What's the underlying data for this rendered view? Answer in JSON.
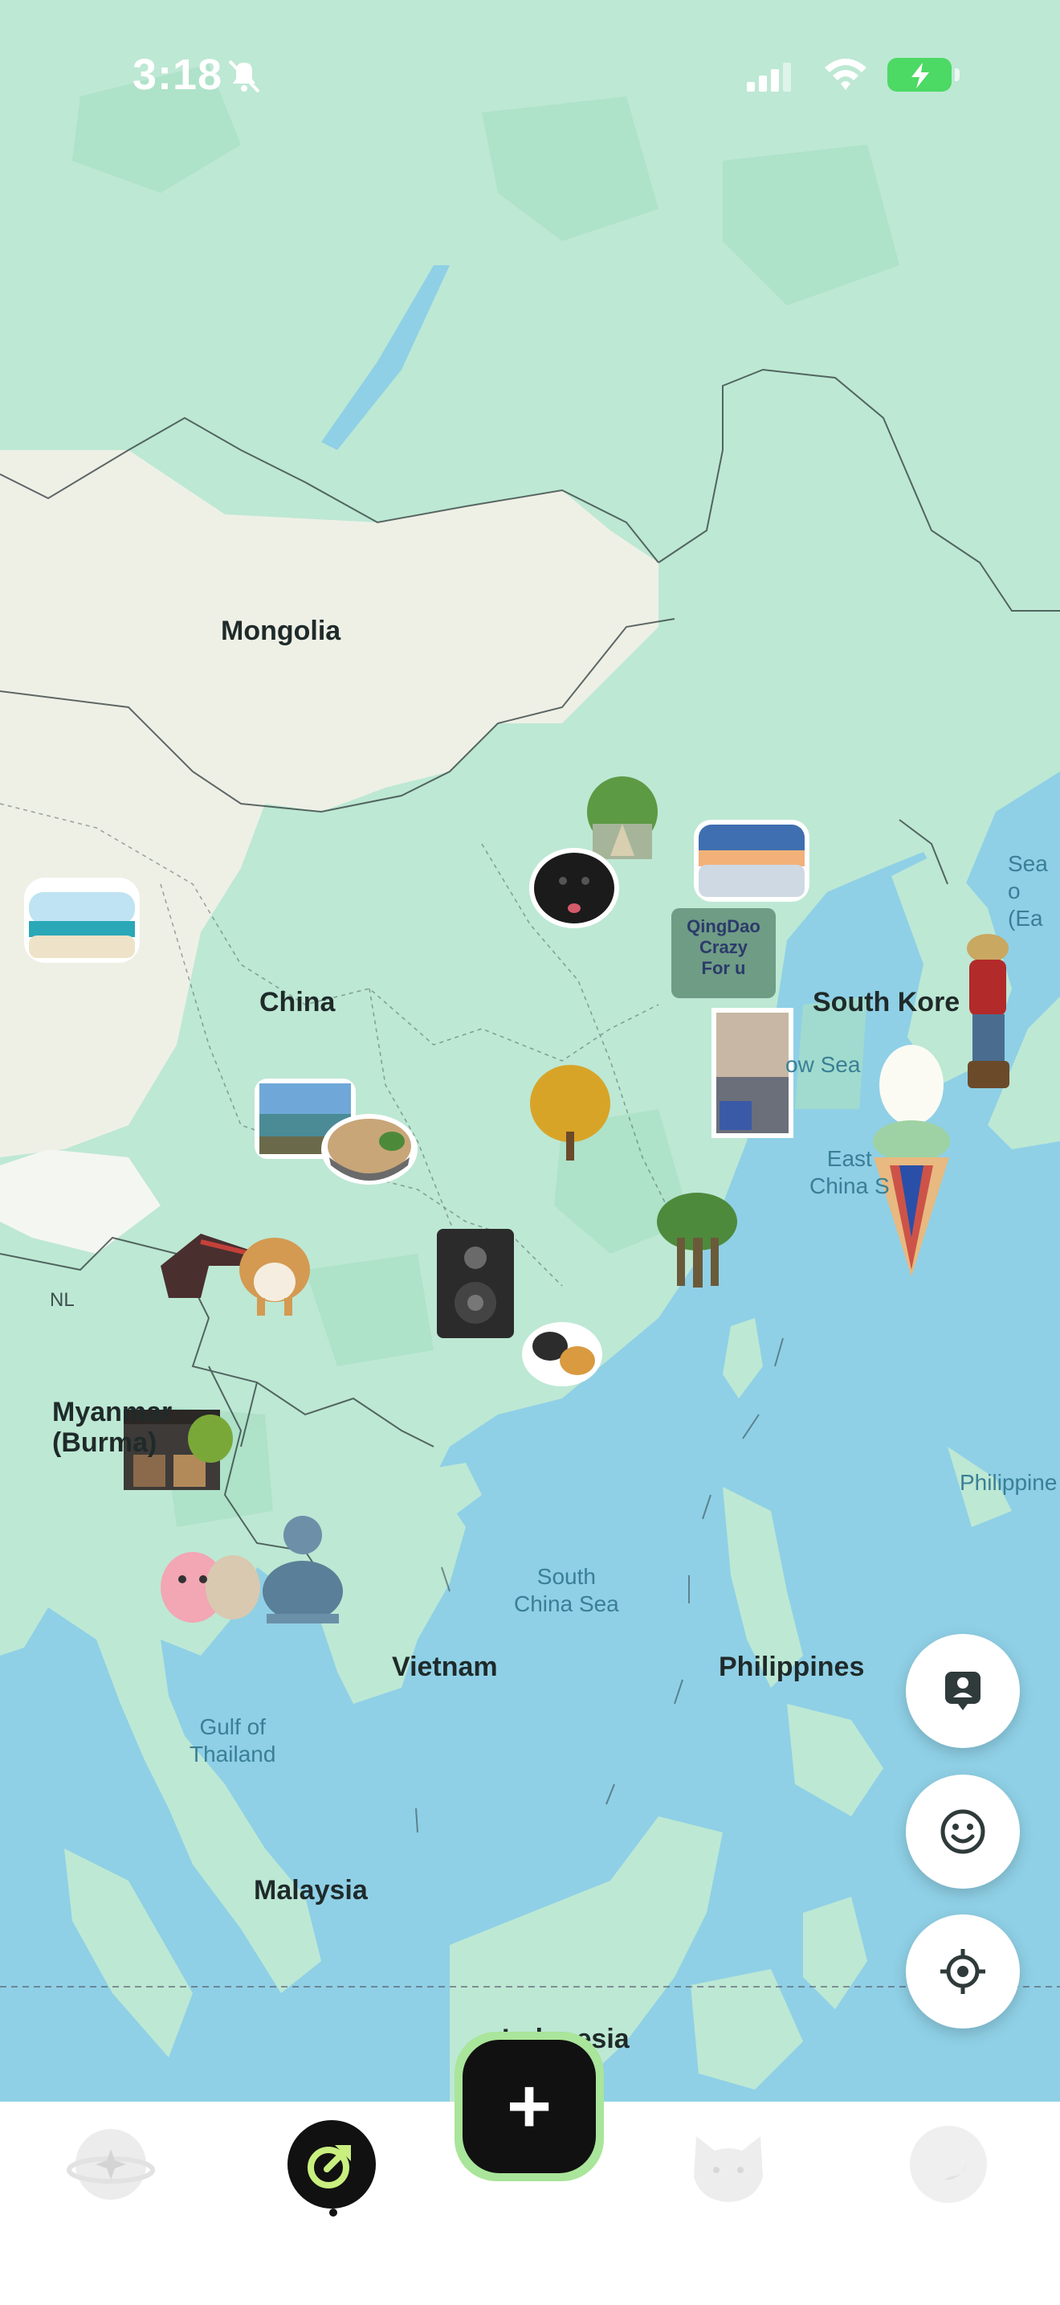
{
  "status": {
    "time": "3:18"
  },
  "map": {
    "countries": {
      "mongolia": "Mongolia",
      "china": "China",
      "south_korea": "South Kore",
      "myanmar": "Myanmar\n(Burma)",
      "vietnam": "Vietnam",
      "philippines": "Philippines",
      "malaysia": "Malaysia",
      "indonesia": "Indonesia"
    },
    "waters": {
      "south_china_sea": "South\nChina Sea",
      "gulf_of_thailand": "Gulf of\nThailand",
      "east_china_sea": "East\nChina S",
      "yellow_sea": "ow Sea",
      "sea_of_japan": "Sea o\n(Ea",
      "philippine_sea": "Philippine"
    },
    "markers": {
      "nl": "NL"
    },
    "sticker_text": "QingDao\nCrazy\nFor u"
  },
  "colors": {
    "land": "#bde8d4",
    "land_dark": "#a8dfc4",
    "desert": "#eef0e6",
    "water": "#8fd0e6",
    "accent_green": "#a9e59a"
  },
  "icons": {
    "contact": "contact-card-icon",
    "emoji": "smiley-face-icon",
    "locate": "locate-crosshair-icon",
    "add": "plus-icon",
    "tab1": "planet-sparkle-icon",
    "tab2": "arrow-path-icon",
    "tab3": "cat-face-icon",
    "tab4": "moon-icon"
  },
  "tabbar": {
    "add_label": "+"
  }
}
